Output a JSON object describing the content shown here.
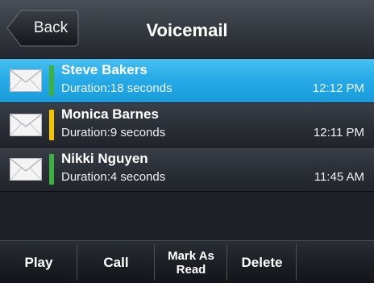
{
  "header": {
    "back_label": "Back",
    "title": "Voicemail"
  },
  "messages": [
    {
      "name": "Steve Bakers",
      "duration": "Duration:18 seconds",
      "time": "12:12 PM",
      "status_color": "#3cb043",
      "selected": true
    },
    {
      "name": "Monica Barnes",
      "duration": "Duration:9 seconds",
      "time": "12:11 PM",
      "status_color": "#f2c500",
      "selected": false
    },
    {
      "name": "Nikki Nguyen",
      "duration": "Duration:4 seconds",
      "time": "11:45 AM",
      "status_color": "#3cb043",
      "selected": false
    }
  ],
  "softkeys": [
    {
      "label": "Play"
    },
    {
      "label": "Call"
    },
    {
      "label": "Mark As\nRead"
    },
    {
      "label": "Delete"
    },
    {
      "label": ""
    }
  ],
  "icons": {
    "message_icon": "envelope-icon",
    "back_icon": "back-arrow-button-shape"
  },
  "colors": {
    "selected_row": "#1fa3e0",
    "accent_green": "#3cb043",
    "accent_yellow": "#f2c500"
  }
}
